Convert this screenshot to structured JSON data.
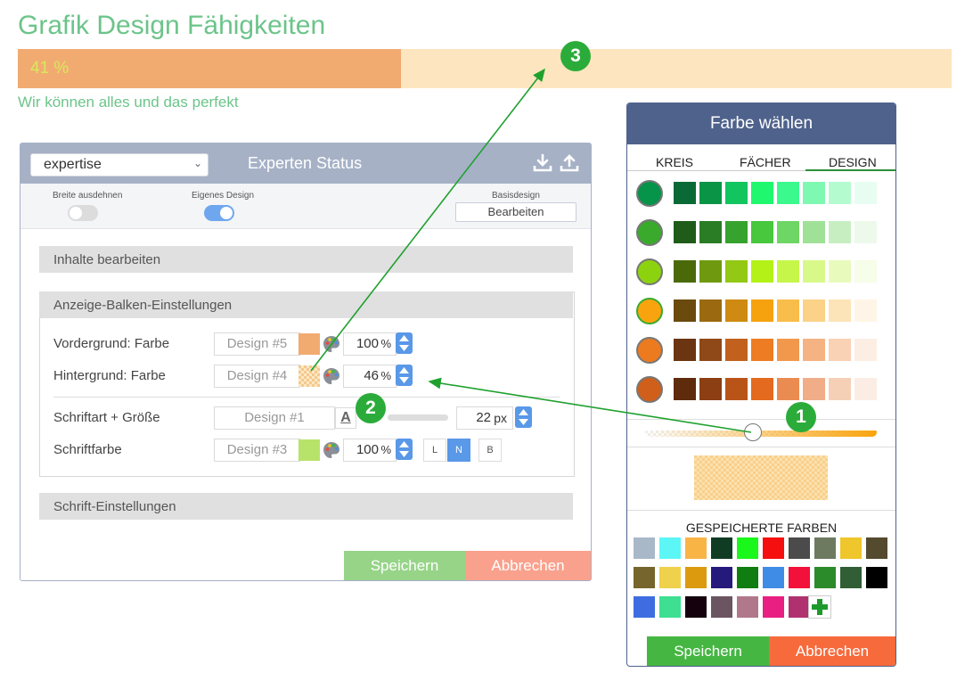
{
  "header": {
    "title": "Grafik Design Fähigkeiten",
    "progress_percent": 41,
    "progress_label": "41 %",
    "subtitle": "Wir können alles und das perfekt",
    "fill_color": "#f1ab71",
    "track_color": "#fde5bf"
  },
  "panel": {
    "select_value": "expertise",
    "title": "Experten Status",
    "icons": [
      "download-icon",
      "upload-icon"
    ],
    "options": {
      "stretch_label": "Breite ausdehnen",
      "stretch_on": false,
      "custom_design_label": "Eigenes Design",
      "custom_design_on": true,
      "base_design_label": "Basisdesign",
      "edit_label": "Bearbeiten"
    },
    "sections": {
      "content": "Inhalte bearbeiten",
      "bar_settings": "Anzeige-Balken-Einstellungen",
      "font_settings": "Schrift-Einstellungen"
    },
    "rows": {
      "foreground": {
        "label": "Vordergrund: Farbe",
        "design": "Design #5",
        "value": "100",
        "unit": "%",
        "swatch": "#f1ab71"
      },
      "background": {
        "label": "Hintergrund: Farbe",
        "design": "Design #4",
        "value": "46",
        "unit": "%",
        "swatch": "#fbd89a"
      },
      "font": {
        "label": "Schriftart + Größe",
        "design": "Design #1",
        "value": "22",
        "unit": "px"
      },
      "font_color": {
        "label": "Schriftfarbe",
        "design": "Design #3",
        "value": "100",
        "unit": "%",
        "swatch": "#b8e36a",
        "styles": [
          "L",
          "N",
          "B"
        ],
        "active_style": "N"
      }
    },
    "save_label": "Speichern",
    "cancel_label": "Abbrechen"
  },
  "picker": {
    "title": "Farbe wählen",
    "tabs": [
      "KREIS",
      "FÄCHER",
      "DESIGN"
    ],
    "active_tab": "DESIGN",
    "rows": [
      {
        "main": "#06934a",
        "shades": [
          "#0a6a35",
          "#0a9446",
          "#12c55e",
          "#1ff86e",
          "#3bf98c",
          "#7ff9b2",
          "#b4fbd0",
          "#e8fdf1"
        ]
      },
      {
        "main": "#3aaa2d",
        "shades": [
          "#1f5c1a",
          "#2a7d24",
          "#36a32e",
          "#48c83d",
          "#6ed664",
          "#9ee197",
          "#c6eec1",
          "#edf9eb"
        ]
      },
      {
        "main": "#8dd20f",
        "shades": [
          "#4a6a0a",
          "#6f9a0f",
          "#93c814",
          "#b4f217",
          "#c6f64a",
          "#d8f98a",
          "#e8fbbd",
          "#f6fde8"
        ]
      },
      {
        "main": "#f9a40e",
        "shades": [
          "#6b4a0e",
          "#9b6a10",
          "#cf8a11",
          "#f6a20f",
          "#f9bd4b",
          "#fbd288",
          "#fde4b8",
          "#fff5e6"
        ]
      },
      {
        "main": "#ec7a1e",
        "shades": [
          "#6a3510",
          "#8f4817",
          "#c1611d",
          "#ed7c22",
          "#f1984d",
          "#f5b384",
          "#f9d1b4",
          "#fdeee3"
        ]
      },
      {
        "main": "#cf5f1a",
        "shades": [
          "#5f2b0d",
          "#8c3f12",
          "#b95418",
          "#e36a1f",
          "#ea8c52",
          "#f0ad87",
          "#f6cfb7",
          "#fbede4"
        ]
      }
    ],
    "opacity_percent": 46,
    "preview_color": "#fbd89a",
    "saved_title": "GESPEICHERTE FARBEN",
    "saved_colors": [
      "#a9b8c8",
      "#5cf6f6",
      "#f9b446",
      "#0f3c23",
      "#19f81a",
      "#f50f0f",
      "#4b4b4b",
      "#6d7a60",
      "#efc62b",
      "#544a2d",
      "#76652c",
      "#efd14c",
      "#dc9a0f",
      "#25197c",
      "#0f7d10",
      "#3f8ce6",
      "#f2113a",
      "#2b8a2a",
      "#315e35",
      "#000000",
      "#3d6de0",
      "#3edf91",
      "#15000d",
      "#6b5561",
      "#b1788b",
      "#e91f82",
      "#b03170"
    ],
    "add_icon": "plus-icon",
    "save_label": "Speichern",
    "cancel_label": "Abbrechen"
  },
  "markers": [
    "1",
    "2",
    "3"
  ]
}
